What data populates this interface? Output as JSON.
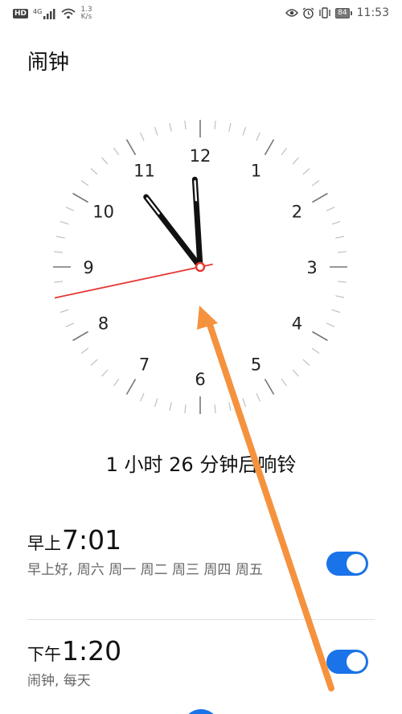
{
  "status_bar": {
    "hd": "HD",
    "network": "4G",
    "speed_value": "1.3",
    "speed_unit": "K/s",
    "battery": "84",
    "time": "11:53",
    "icons": [
      "signal-icon",
      "wifi-icon",
      "eye-icon",
      "alarm-icon",
      "vibrate-icon",
      "battery-icon"
    ]
  },
  "page": {
    "title": "闹钟"
  },
  "clock": {
    "numerals": [
      "12",
      "1",
      "2",
      "3",
      "4",
      "5",
      "6",
      "7",
      "8",
      "9",
      "10",
      "11"
    ],
    "hour": 11,
    "minute": 53,
    "second": 43,
    "second_hand_color": "#e53935"
  },
  "countdown": "1 小时 26 分钟后响铃",
  "alarms": [
    {
      "period": "早上",
      "time": "7:01",
      "description": "早上好, 周六 周一 周二 周三 周四 周五",
      "enabled": true
    },
    {
      "period": "下午",
      "time": "1:20",
      "description": "闹钟, 每天",
      "enabled": true
    }
  ],
  "colors": {
    "accent": "#1a73e8",
    "annotation_arrow": "#f5923e"
  }
}
